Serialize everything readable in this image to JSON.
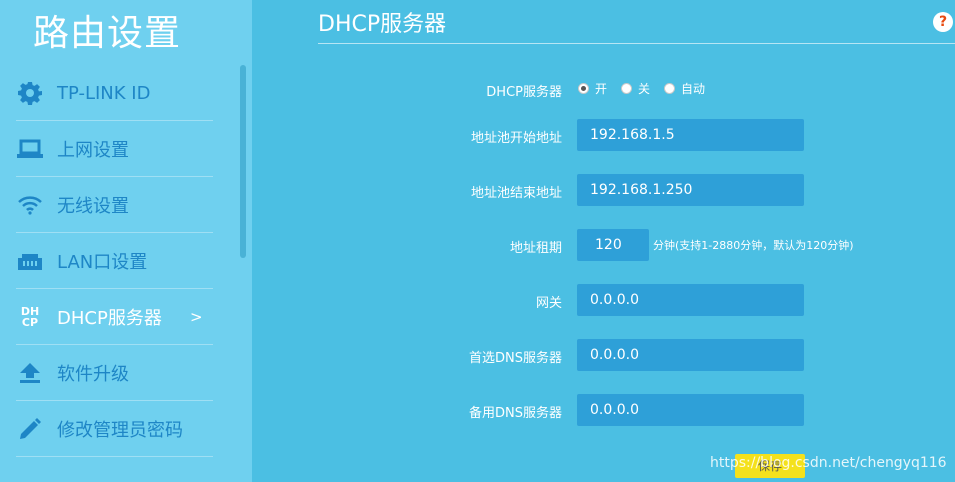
{
  "sidebar": {
    "title": "路由设置",
    "items": [
      {
        "label": "TP-LINK ID",
        "icon": "gear-icon"
      },
      {
        "label": "上网设置",
        "icon": "laptop-icon"
      },
      {
        "label": "无线设置",
        "icon": "wifi-icon"
      },
      {
        "label": "LAN口设置",
        "icon": "lan-port-icon"
      },
      {
        "label": "DHCP服务器",
        "icon": "dhcp-icon",
        "icon_text_top": "DH",
        "icon_text_bottom": "CP",
        "chevron": ">"
      },
      {
        "label": "软件升级",
        "icon": "upload-icon"
      },
      {
        "label": "修改管理员密码",
        "icon": "pencil-icon"
      }
    ],
    "active_index": 4
  },
  "main": {
    "title": "DHCP服务器",
    "help": "?",
    "dhcp_server": {
      "label": "DHCP服务器",
      "options": [
        "开",
        "关",
        "自动"
      ],
      "selected": "开"
    },
    "start_address": {
      "label": "地址池开始地址",
      "value": "192.168.1.5"
    },
    "end_address": {
      "label": "地址池结束地址",
      "value": "192.168.1.250"
    },
    "lease": {
      "label": "地址租期",
      "value": "120",
      "hint": "分钟(支持1-2880分钟，默认为120分钟)"
    },
    "gateway": {
      "label": "网关",
      "value": "0.0.0.0"
    },
    "primary_dns": {
      "label": "首选DNS服务器",
      "value": "0.0.0.0"
    },
    "secondary_dns": {
      "label": "备用DNS服务器",
      "value": "0.0.0.0"
    },
    "save_label": "保存",
    "watermark": "https://blog.csdn.net/chengyq116"
  },
  "colors": {
    "sidebar_bg": "#6fd0ef",
    "main_bg": "#4bbfe3",
    "field_bg": "#2ea0d8",
    "nav_text": "#1e86c6",
    "save_bg": "#f4e11c"
  }
}
